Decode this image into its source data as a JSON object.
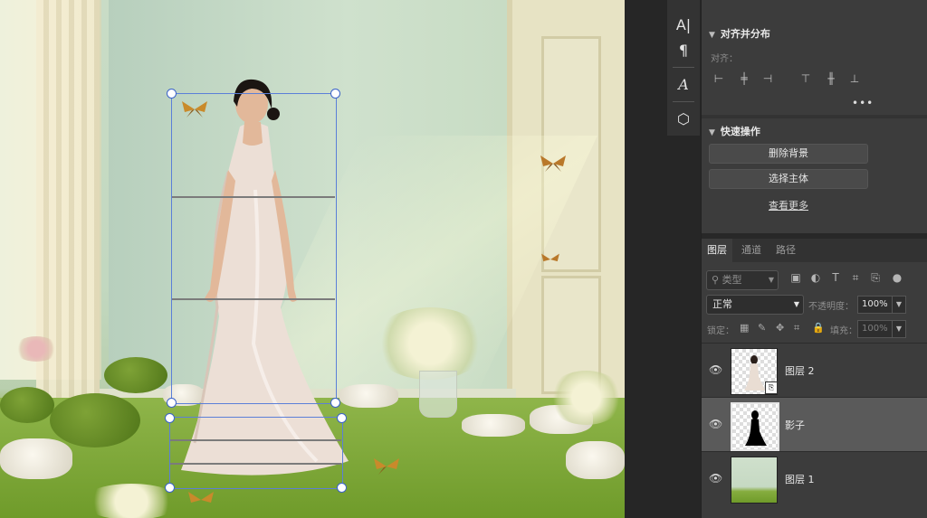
{
  "toolstrip": {
    "items": [
      {
        "name": "character-panel-icon",
        "glyph": "A|"
      },
      {
        "name": "paragraph-panel-icon",
        "glyph": "¶"
      },
      {
        "name": "glyphs-panel-icon",
        "glyph": "A"
      },
      {
        "name": "3d-panel-icon",
        "glyph": "⬡"
      }
    ]
  },
  "align": {
    "title": "对齐并分布",
    "sublabel": "对齐：",
    "more": "•••"
  },
  "quick_actions": {
    "title": "快速操作",
    "remove_bg": "删除背景",
    "select_subject": "选择主体",
    "view_more": "查看更多"
  },
  "layers_panel": {
    "tabs": [
      "图层",
      "通道",
      "路径"
    ],
    "filter_placeholder": "类型",
    "blend_mode": "正常",
    "opacity_label": "不透明度：",
    "opacity_value": "100%",
    "lock_label": "锁定：",
    "fill_label": "填充：",
    "fill_value": "100%",
    "layers": [
      {
        "name": "图层 2",
        "selected": false
      },
      {
        "name": "影子",
        "selected": true
      },
      {
        "name": "图层 1",
        "selected": false
      }
    ]
  },
  "colors": {
    "panel_bg": "#3c3c3c",
    "selected_layer": "#5a5a5a",
    "transform_box": "#5b7fd8"
  }
}
